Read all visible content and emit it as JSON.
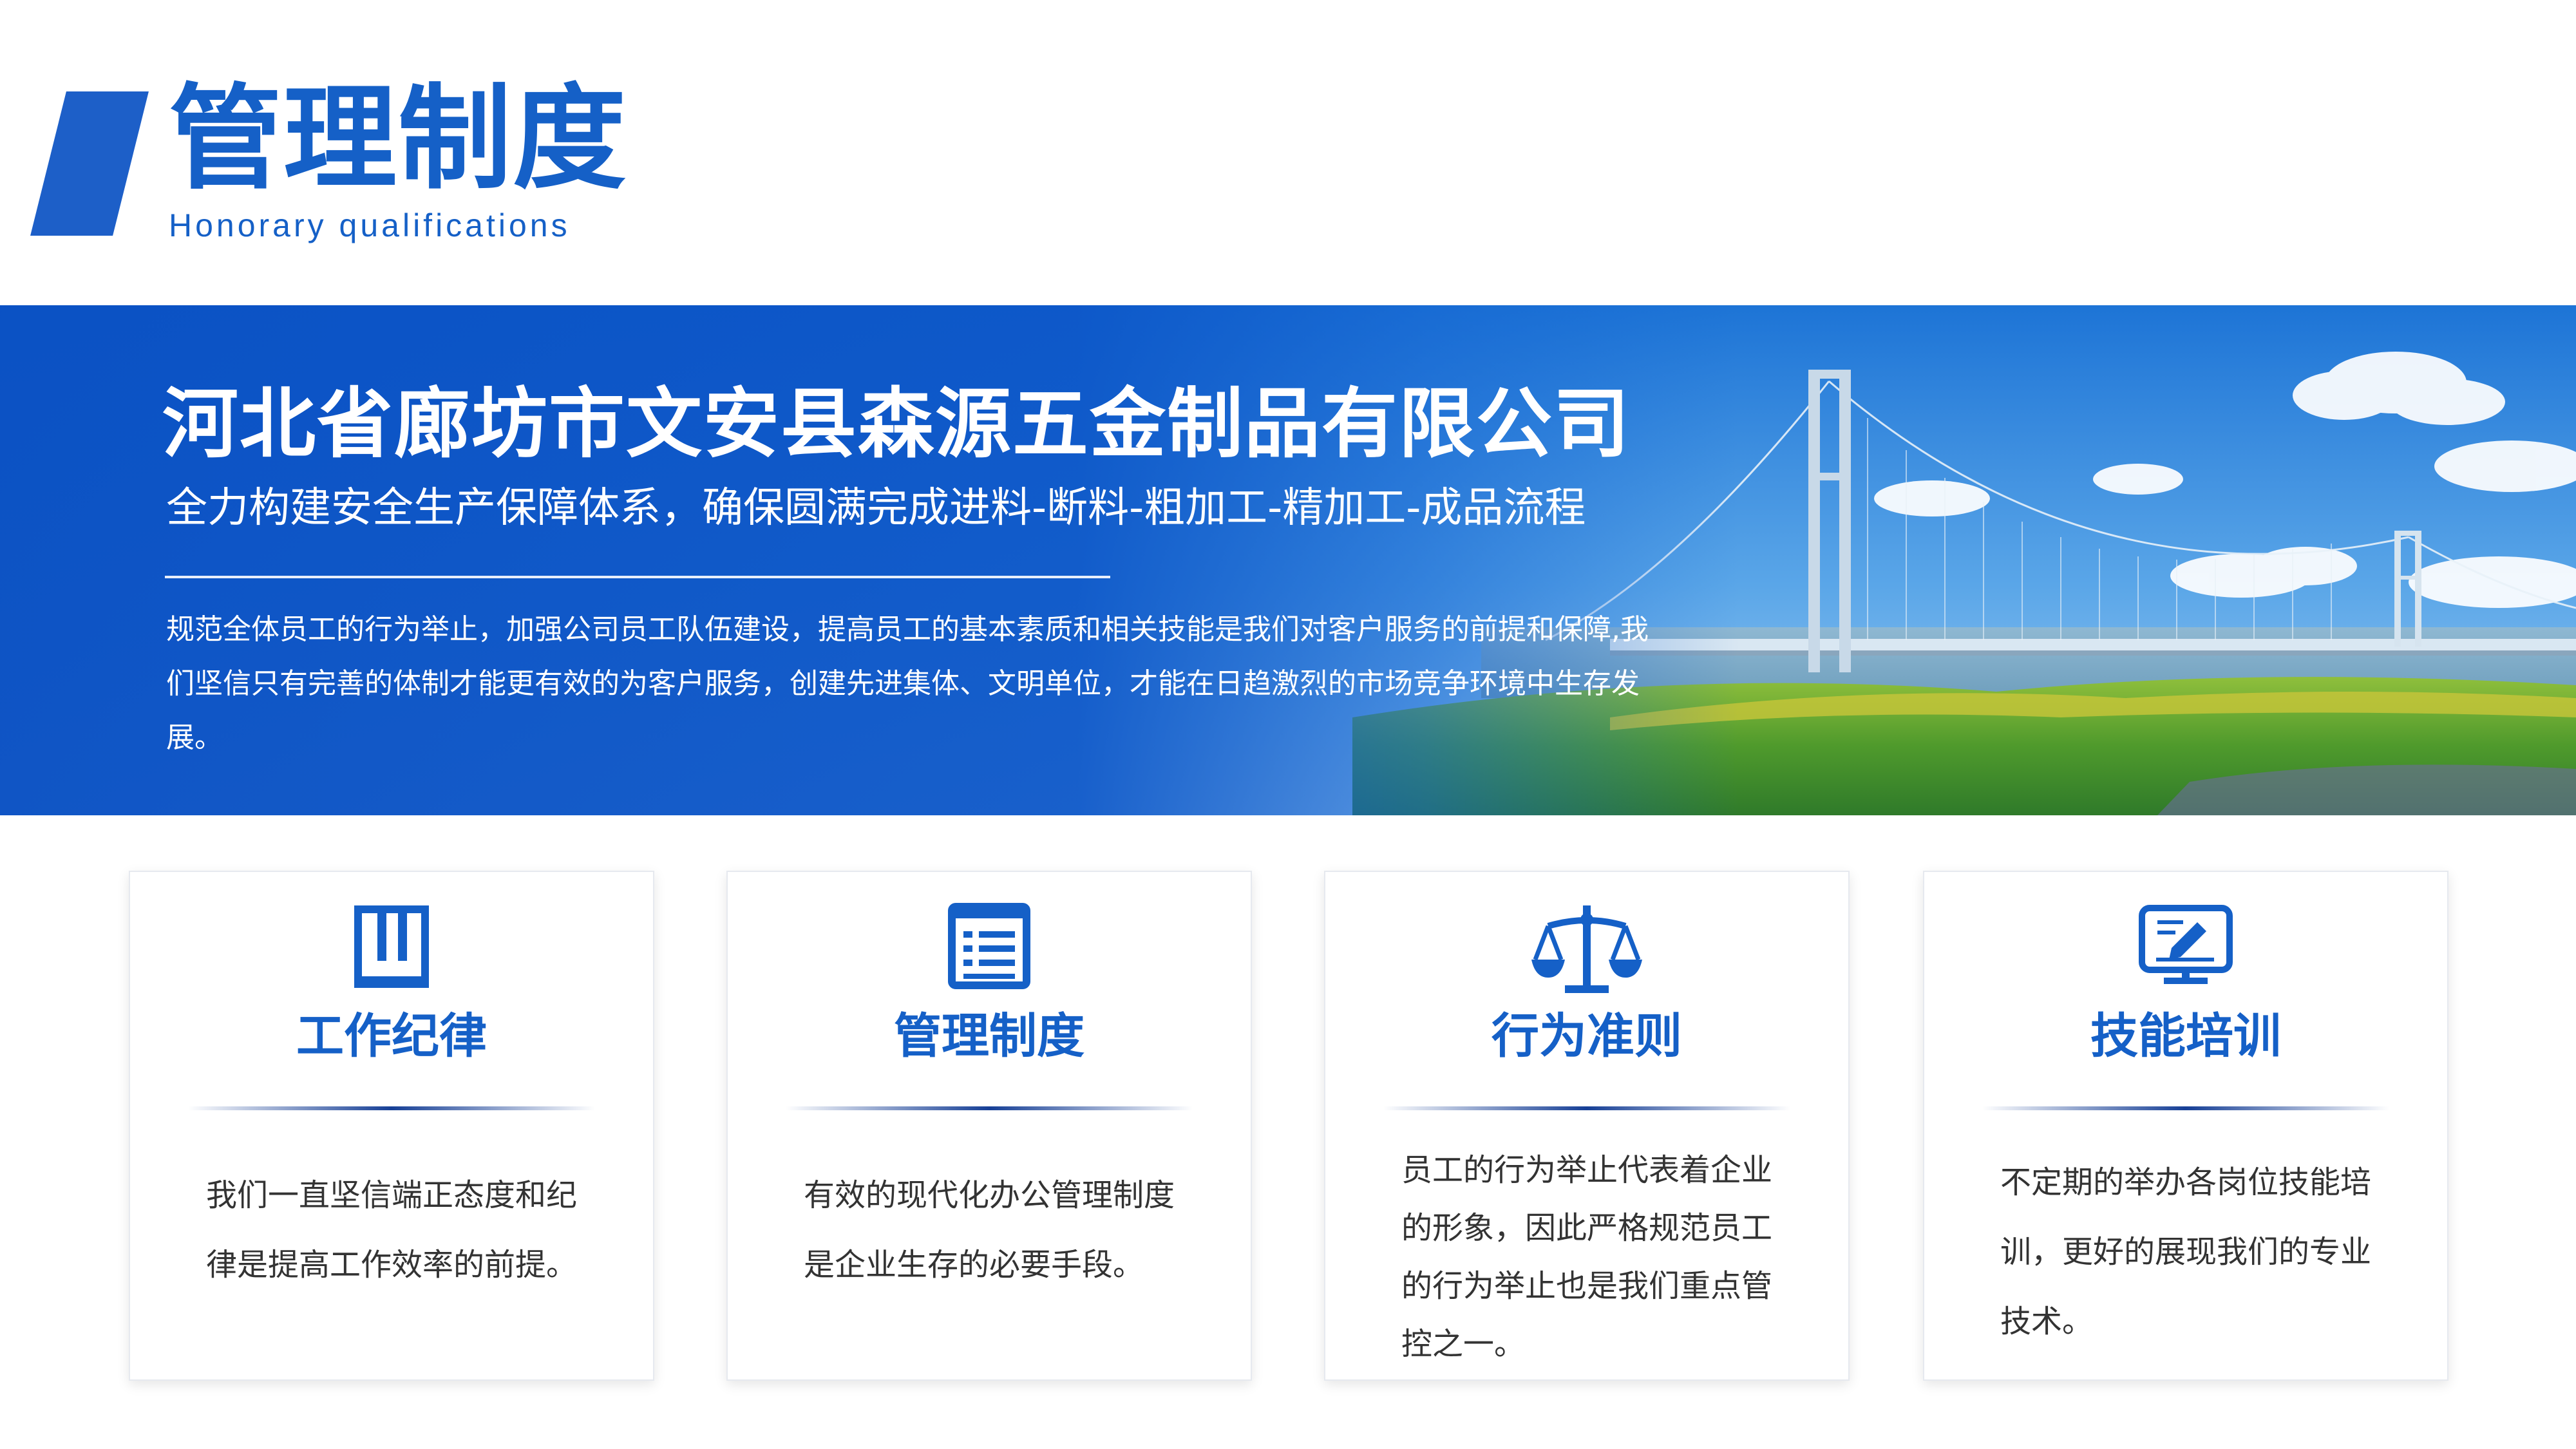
{
  "header": {
    "title": "管理制度",
    "subtitle": "Honorary qualifications"
  },
  "banner": {
    "company_name": "河北省廊坊市文安县森源五金制品有限公司",
    "slogan": "全力构建安全生产保障体系，确保圆满完成进料-断料-粗加工-精加工-成品流程",
    "intro": "规范全体员工的行为举止，加强公司员工队伍建设，提高员工的基本素质和相关技能是我们对客户服务的前提和保障,我们坚信只有完善的体制才能更有效的为客户服务，创建先进集体、文明单位，才能在日趋激烈的市场竞争环境中生存发展。"
  },
  "cards": [
    {
      "icon": "book-icon",
      "title": "工作纪律",
      "text": "我们一直坚信端正态度和纪律是提高工作效率的前提。"
    },
    {
      "icon": "document-list-icon",
      "title": "管理制度",
      "text": "有效的现代化办公管理制度是企业生存的必要手段。"
    },
    {
      "icon": "scales-icon",
      "title": "行为准则",
      "text": "员工的行为举止代表着企业的形象，因此严格规范员工的行为举止也是我们重点管控之一。"
    },
    {
      "icon": "computer-edit-icon",
      "title": "技能培训",
      "text": "不定期的举办各岗位技能培训，更好的展现我们的专业技术。"
    }
  ],
  "colors": {
    "accent": "#1560c7",
    "banner_blue": "#0d56c8",
    "body_text": "#333333"
  }
}
